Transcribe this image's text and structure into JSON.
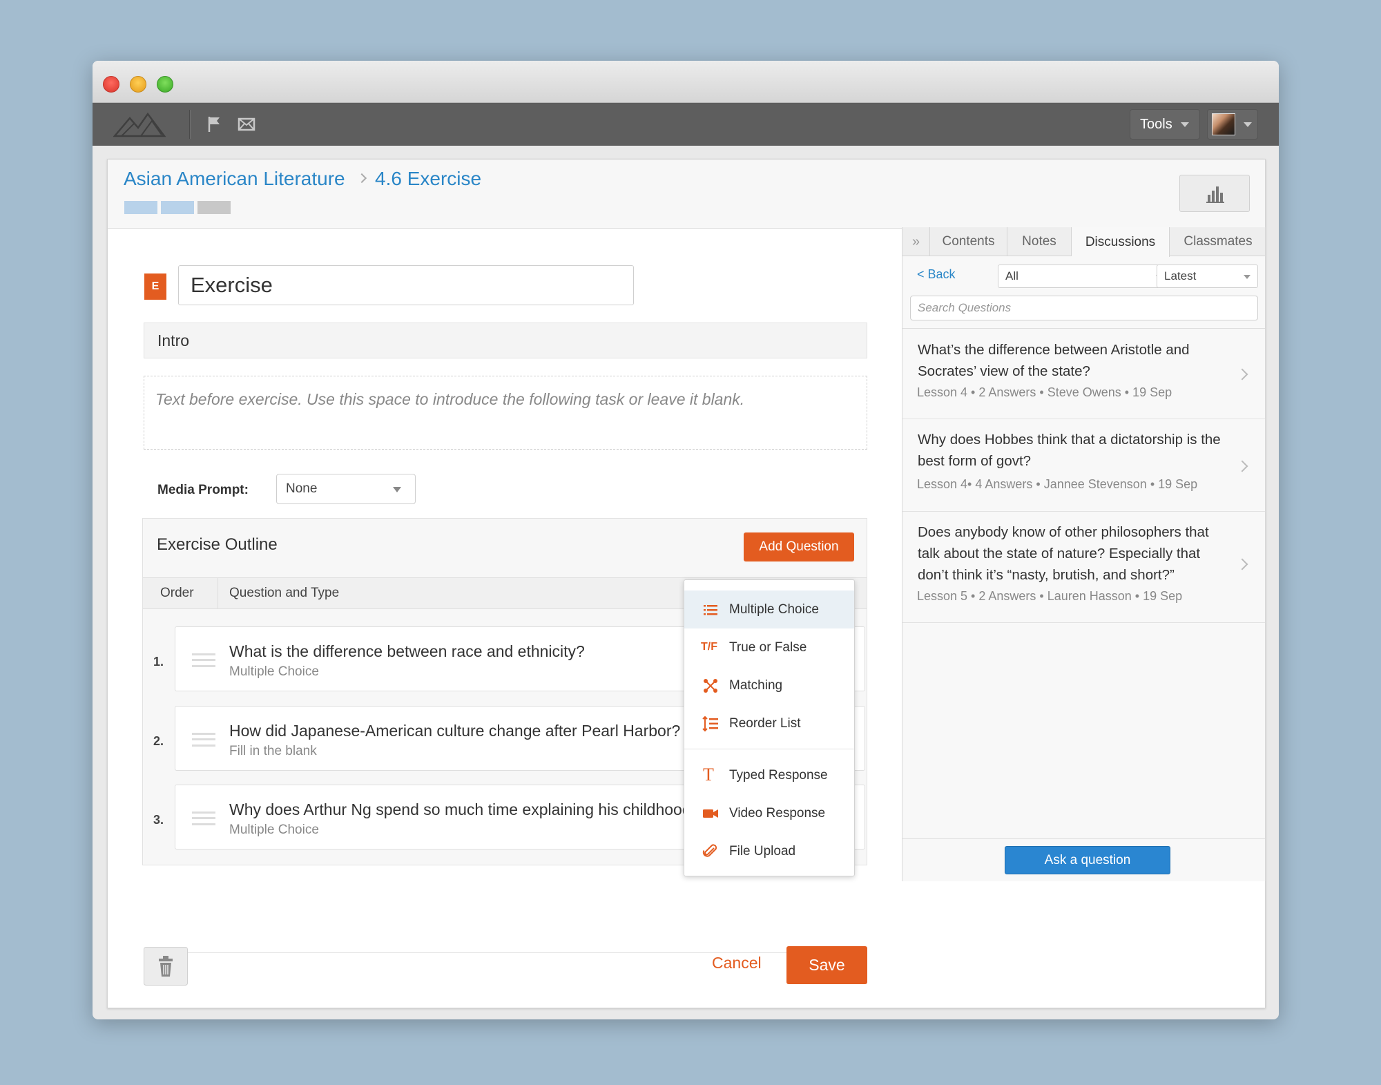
{
  "header": {
    "breadcrumb": [
      "Asian American Literature",
      "4.6 Exercise"
    ],
    "progress_colors": [
      "#b8d2ea",
      "#b8d2ea",
      "#c8c8c8"
    ]
  },
  "toolbar": {
    "tools_label": "Tools"
  },
  "editor": {
    "badge": "E",
    "title": "Exercise",
    "intro_label": "Intro",
    "intro_placeholder": "Text before exercise. Use this space to introduce the following task or leave it blank.",
    "media_prompt_label": "Media Prompt:",
    "media_prompt_value": "None"
  },
  "outline": {
    "title": "Exercise Outline",
    "add_question_label": "Add Question",
    "columns": [
      "Order",
      "Question and Type"
    ],
    "questions": [
      {
        "num": "1.",
        "text": "What is the difference between race and ethnicity?",
        "type": "Multiple Choice"
      },
      {
        "num": "2.",
        "text": "How did Japanese-American culture change after Pearl Harbor?",
        "type": "Fill in the blank"
      },
      {
        "num": "3.",
        "text": "Why does Arthur Ng spend so much time explaining his childhood?",
        "type": "Multiple Choice"
      }
    ]
  },
  "question_types": [
    {
      "label": "Multiple Choice",
      "icon": "list-icon"
    },
    {
      "label": "True or False",
      "icon": "true-false-icon",
      "glyph": "T/F"
    },
    {
      "label": "Matching",
      "icon": "matching-icon"
    },
    {
      "label": "Reorder List",
      "icon": "reorder-icon"
    },
    {
      "label": "Typed Response",
      "icon": "text-icon",
      "glyph": "T"
    },
    {
      "label": "Video Response",
      "icon": "video-icon"
    },
    {
      "label": "File Upload",
      "icon": "paperclip-icon"
    }
  ],
  "footer": {
    "cancel_label": "Cancel",
    "save_label": "Save"
  },
  "sidebar": {
    "tabs": [
      "Contents",
      "Notes",
      "Discussions",
      "Classmates"
    ],
    "active_tab": "Discussions",
    "back_label": "< Back",
    "filter_value": "All",
    "sort_value": "Latest",
    "search_placeholder": "Search Questions",
    "discussions": [
      {
        "title": "What’s the difference between Aristotle and Socrates’ view of the state?",
        "meta": "Lesson 4 • 2 Answers • Steve Owens • 19 Sep"
      },
      {
        "title": "Why does Hobbes think that a dictatorship is the best form of govt?",
        "meta": "Lesson 4• 4 Answers • Jannee Stevenson • 19 Sep"
      },
      {
        "title": "Does anybody know of other philosophers that talk about the state of nature? Especially that don’t think it’s “nasty, brutish, and short?”",
        "meta": "Lesson 5 • 2 Answers • Lauren Hasson • 19 Sep"
      }
    ],
    "ask_label": "Ask a question"
  },
  "colors": {
    "accent": "#e35c20",
    "link": "#2a86c7",
    "primary_button": "#2a86d1"
  }
}
